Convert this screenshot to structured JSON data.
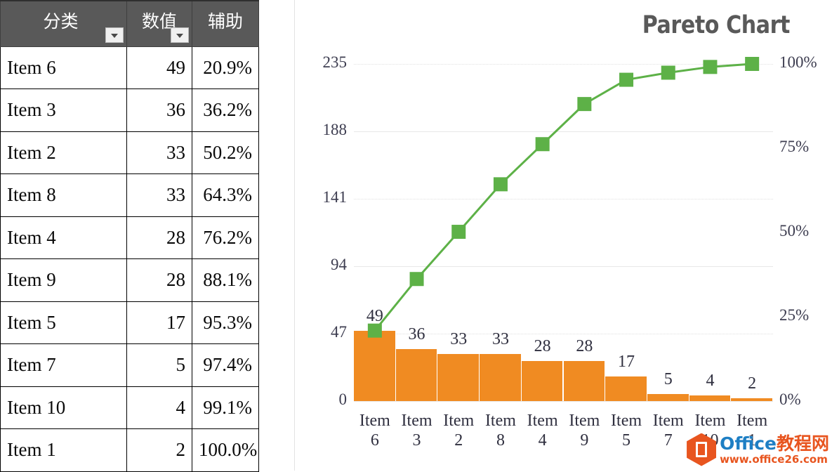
{
  "table": {
    "headers": [
      {
        "label": "分类",
        "has_filter": true
      },
      {
        "label": "数值",
        "has_filter": true
      },
      {
        "label": "辅助",
        "has_filter": false
      }
    ],
    "rows": [
      {
        "category": "Item 6",
        "value": "49",
        "percent": "20.9%"
      },
      {
        "category": "Item 3",
        "value": "36",
        "percent": "36.2%"
      },
      {
        "category": "Item 2",
        "value": "33",
        "percent": "50.2%"
      },
      {
        "category": "Item 8",
        "value": "33",
        "percent": "64.3%"
      },
      {
        "category": "Item 4",
        "value": "28",
        "percent": "76.2%"
      },
      {
        "category": "Item 9",
        "value": "28",
        "percent": "88.1%"
      },
      {
        "category": "Item 5",
        "value": "17",
        "percent": "95.3%"
      },
      {
        "category": "Item 7",
        "value": "5",
        "percent": "97.4%"
      },
      {
        "category": "Item 10",
        "value": "4",
        "percent": "99.1%"
      },
      {
        "category": "Item 1",
        "value": "2",
        "percent": "100.0%"
      }
    ]
  },
  "chart_data": {
    "type": "bar",
    "title": "Pareto Chart",
    "xlabel": "",
    "ylabel": "",
    "categories": [
      "Item 6",
      "Item 3",
      "Item 2",
      "Item 8",
      "Item 4",
      "Item 9",
      "Item 5",
      "Item 7",
      "Item 10",
      "Item 1"
    ],
    "category_lines": [
      {
        "l1": "Item",
        "l2": "6"
      },
      {
        "l1": "Item",
        "l2": "3"
      },
      {
        "l1": "Item",
        "l2": "2"
      },
      {
        "l1": "Item",
        "l2": "8"
      },
      {
        "l1": "Item",
        "l2": "4"
      },
      {
        "l1": "Item",
        "l2": "9"
      },
      {
        "l1": "Item",
        "l2": "5"
      },
      {
        "l1": "Item",
        "l2": "7"
      },
      {
        "l1": "Item",
        "l2": "10"
      },
      {
        "l1": "Item",
        "l2": "1"
      }
    ],
    "series": [
      {
        "name": "数值",
        "type": "bar",
        "color": "#F08B22",
        "axis": "left",
        "values": [
          49,
          36,
          33,
          33,
          28,
          28,
          17,
          5,
          4,
          2
        ],
        "labels": [
          "49",
          "36",
          "33",
          "33",
          "28",
          "28",
          "17",
          "5",
          "4",
          "2"
        ]
      },
      {
        "name": "辅助",
        "type": "line",
        "color": "#5DB147",
        "axis": "right",
        "values": [
          20.9,
          36.2,
          50.2,
          64.3,
          76.2,
          88.1,
          95.3,
          97.4,
          99.1,
          100.0
        ]
      }
    ],
    "y_left": {
      "ticks": [
        "0",
        "47",
        "94",
        "141",
        "188",
        "235"
      ],
      "tick_values": [
        0,
        47,
        94,
        141,
        188,
        235
      ],
      "min": 0,
      "max": 235
    },
    "y_right": {
      "ticks": [
        "0%",
        "25%",
        "50%",
        "75%",
        "100%"
      ],
      "tick_values": [
        0,
        25,
        50,
        75,
        100
      ],
      "min": 0,
      "max": 100
    },
    "grid": true,
    "legend": "none"
  },
  "watermark": {
    "brand": "Office",
    "brand_cn": "教程网",
    "url": "www.office26.com"
  }
}
